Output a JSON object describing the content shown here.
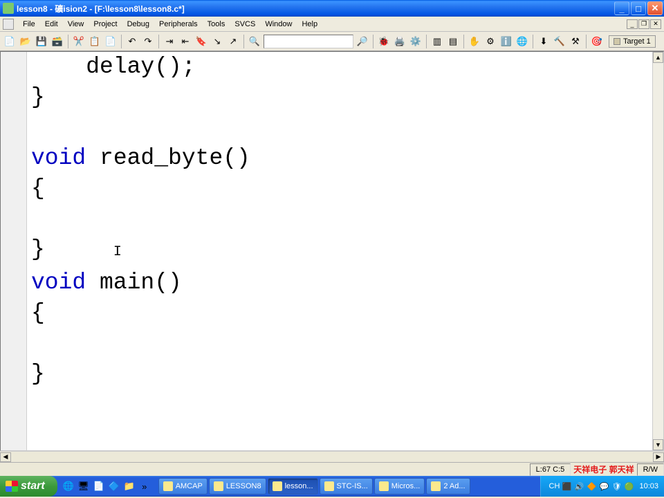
{
  "titlebar": {
    "title": "lesson8 - 礦ision2 - [F:\\lesson8\\lesson8.c*]"
  },
  "menu": {
    "items": [
      "File",
      "Edit",
      "View",
      "Project",
      "Debug",
      "Peripherals",
      "Tools",
      "SVCS",
      "Window",
      "Help"
    ]
  },
  "toolbar": {
    "target_label": "Target 1"
  },
  "code": {
    "l1_indent": "    ",
    "l1_text": "delay();",
    "l2": "}",
    "l3": "",
    "l4a": "void",
    "l4b": " read_byte()",
    "l5": "{",
    "l6": "",
    "l7": "}",
    "l8a": "void",
    "l8b": " main()",
    "l9": "{",
    "l10": "",
    "l11": "}",
    "cursor_char": "I"
  },
  "status": {
    "position": "L:67 C:5",
    "rw": "R/W",
    "overlay": "天祥电子   郭天祥"
  },
  "taskbar": {
    "start": "start",
    "tasks": [
      {
        "label": "AMCAP"
      },
      {
        "label": "LESSON8"
      },
      {
        "label": "lesson..."
      },
      {
        "label": "STC-IS..."
      },
      {
        "label": "Micros..."
      },
      {
        "label": "2 Ad..."
      }
    ],
    "lang": "CH",
    "clock": "10:03"
  }
}
